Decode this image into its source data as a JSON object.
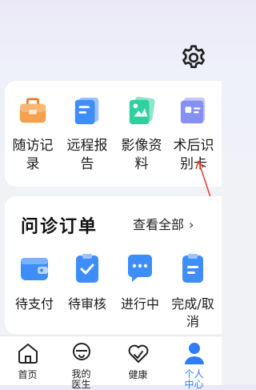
{
  "header": {
    "settings_icon": "gear-icon"
  },
  "services": [
    {
      "label": "随访记录",
      "icon": "briefcase-icon",
      "color": "#f29a45"
    },
    {
      "label": "远程报告",
      "icon": "report-icon",
      "color": "#3d8ef8"
    },
    {
      "label": "影像资料",
      "icon": "image-data-icon",
      "color": "#2fcfa0"
    },
    {
      "label": "术后识别卡",
      "icon": "id-card-icon",
      "color": "#8590f0"
    }
  ],
  "orders": {
    "title": "问诊订单",
    "view_all": "查看全部",
    "items": [
      {
        "label": "待支付",
        "icon": "wallet-icon"
      },
      {
        "label": "待审核",
        "icon": "check-clipboard-icon"
      },
      {
        "label": "进行中",
        "icon": "chat-dots-icon"
      },
      {
        "label": "完成/取消",
        "icon": "done-cancel-icon"
      }
    ]
  },
  "tabs": [
    {
      "label": "首页",
      "icon": "home-icon",
      "active": false
    },
    {
      "label": "我的医生",
      "icon": "doctor-icon",
      "active": false
    },
    {
      "label": "健康",
      "icon": "heart-icon",
      "active": false
    },
    {
      "label": "个人中心",
      "icon": "user-icon",
      "active": true
    }
  ],
  "colors": {
    "accent": "#2e7cf6",
    "annotation": "#e23b2e"
  }
}
